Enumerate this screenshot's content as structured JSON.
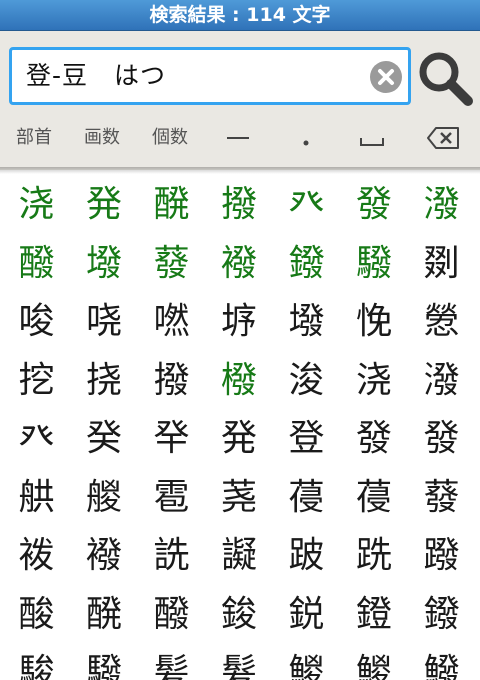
{
  "title_bar": {
    "title": "検索結果 : 114 文字"
  },
  "search": {
    "query": "登-豆　はつ",
    "clear_icon": "clear-circle-x-icon",
    "search_icon": "magnifier-icon"
  },
  "filters": {
    "radical_label": "部首",
    "strokes_label": "画数",
    "count_label": "個数",
    "symbols": [
      "horizontal-line-icon",
      "dot-icon",
      "space-bracket-icon",
      "backspace-icon"
    ]
  },
  "colors": {
    "title_bar": "#3d86c9",
    "search_border": "#34a3f0",
    "highlight_kanji": "#177a17",
    "normal_kanji": "#1a1a1a",
    "panel_bg": "#eae8e3"
  },
  "results": {
    "rows": [
      [
        {
          "c": "浇",
          "hl": true
        },
        {
          "c": "発",
          "hl": true
        },
        {
          "c": "醗",
          "hl": true
        },
        {
          "c": "撥",
          "hl": true
        },
        {
          "c": "癶",
          "hl": true
        },
        {
          "c": "發",
          "hl": true
        },
        {
          "c": "潑",
          "hl": true
        }
      ],
      [
        {
          "c": "醱",
          "hl": true
        },
        {
          "c": "墢",
          "hl": true
        },
        {
          "c": "蕟",
          "hl": true
        },
        {
          "c": "襏",
          "hl": true
        },
        {
          "c": "鏺",
          "hl": true
        },
        {
          "c": "驋",
          "hl": true
        },
        {
          "c": "剟",
          "hl": false
        }
      ],
      [
        {
          "c": "唆",
          "hl": false
        },
        {
          "c": "哓",
          "hl": false
        },
        {
          "c": "嘫",
          "hl": false
        },
        {
          "c": "垿",
          "hl": false
        },
        {
          "c": "墢",
          "hl": false
        },
        {
          "c": "悗",
          "hl": false
        },
        {
          "c": "憥",
          "hl": false
        }
      ],
      [
        {
          "c": "挖",
          "hl": false
        },
        {
          "c": "挠",
          "hl": false
        },
        {
          "c": "撥",
          "hl": false
        },
        {
          "c": "橃",
          "hl": true
        },
        {
          "c": "浚",
          "hl": false
        },
        {
          "c": "浇",
          "hl": false
        },
        {
          "c": "潑",
          "hl": false
        }
      ],
      [
        {
          "c": "癶",
          "hl": false
        },
        {
          "c": "癸",
          "hl": false
        },
        {
          "c": "癷",
          "hl": false
        },
        {
          "c": "発",
          "hl": false
        },
        {
          "c": "登",
          "hl": false
        },
        {
          "c": "發",
          "hl": false
        },
        {
          "c": "發",
          "hl": false
        }
      ],
      [
        {
          "c": "舼",
          "hl": false
        },
        {
          "c": "艐",
          "hl": false
        },
        {
          "c": "雹",
          "hl": false
        },
        {
          "c": "荛",
          "hl": false
        },
        {
          "c": "葠",
          "hl": false
        },
        {
          "c": "葠",
          "hl": false
        },
        {
          "c": "蕟",
          "hl": false
        }
      ],
      [
        {
          "c": "袯",
          "hl": false
        },
        {
          "c": "襏",
          "hl": false
        },
        {
          "c": "詵",
          "hl": false
        },
        {
          "c": "譺",
          "hl": false
        },
        {
          "c": "跛",
          "hl": false
        },
        {
          "c": "跣",
          "hl": false
        },
        {
          "c": "蹳",
          "hl": false
        }
      ],
      [
        {
          "c": "酸",
          "hl": false
        },
        {
          "c": "醗",
          "hl": false
        },
        {
          "c": "醱",
          "hl": false
        },
        {
          "c": "鋑",
          "hl": false
        },
        {
          "c": "鋭",
          "hl": false
        },
        {
          "c": "鐙",
          "hl": false
        },
        {
          "c": "鏺",
          "hl": false
        }
      ],
      [
        {
          "c": "駿",
          "hl": false
        },
        {
          "c": "驋",
          "hl": false
        },
        {
          "c": "髪",
          "hl": false
        },
        {
          "c": "髮",
          "hl": false
        },
        {
          "c": "鯼",
          "hl": false
        },
        {
          "c": "鯼",
          "hl": false
        },
        {
          "c": "鱍",
          "hl": false
        }
      ]
    ]
  }
}
